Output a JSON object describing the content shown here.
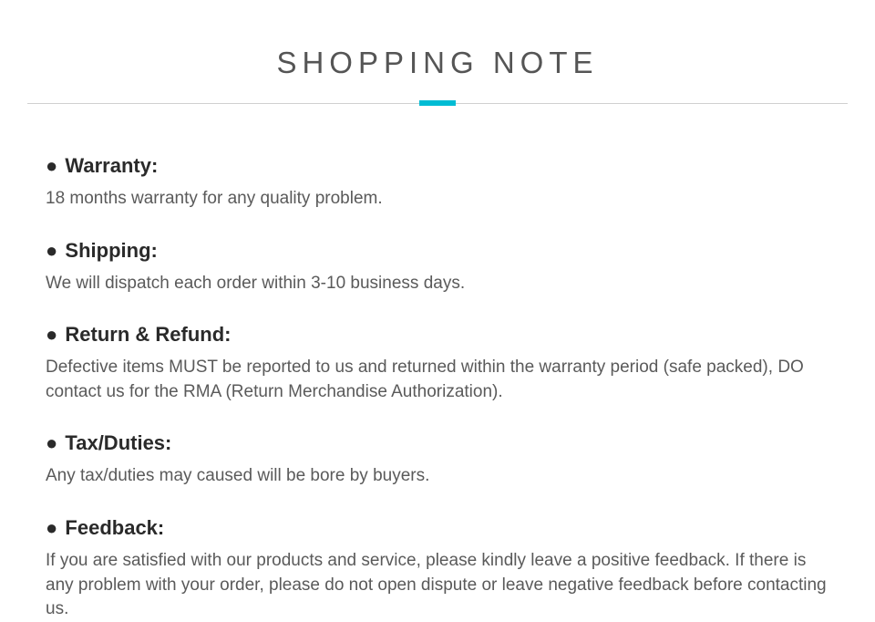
{
  "title": "SHOPPING NOTE",
  "notes": [
    {
      "heading": "Warranty:",
      "body": "18 months warranty for any quality problem."
    },
    {
      "heading": "Shipping:",
      "body": "We will dispatch each order within 3-10 business days."
    },
    {
      "heading": "Return & Refund:",
      "body": "Defective items MUST be reported to us and  returned within the warranty period (safe packed), DO contact us for the RMA (Return Merchandise Authorization)."
    },
    {
      "heading": "Tax/Duties:",
      "body": "Any tax/duties may caused will be bore by buyers."
    },
    {
      "heading": "Feedback:",
      "body": "If you are satisfied with our products and service, please kindly leave a positive feedback. If there is any problem with your order, please do not open dispute or leave negative feedback before contacting us."
    }
  ]
}
